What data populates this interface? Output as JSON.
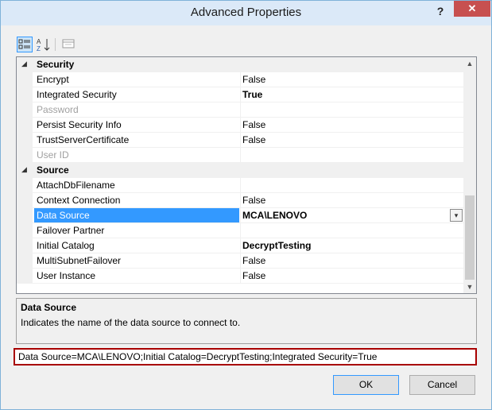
{
  "window": {
    "title": "Advanced Properties",
    "help_label": "?",
    "close_label": "✕"
  },
  "toolbar": {
    "categorized_icon": "categorized-icon",
    "alphabetical_icon": "alphabetical-sort-icon",
    "property_pages_icon": "property-pages-icon"
  },
  "grid": {
    "categories": [
      {
        "label": "Security",
        "expander": "◢",
        "properties": [
          {
            "name": "Encrypt",
            "value": "False"
          },
          {
            "name": "Integrated Security",
            "value": "True"
          },
          {
            "name": "Password",
            "value": ""
          },
          {
            "name": "Persist Security Info",
            "value": "False"
          },
          {
            "name": "TrustServerCertificate",
            "value": "False"
          },
          {
            "name": "User ID",
            "value": ""
          }
        ]
      },
      {
        "label": "Source",
        "expander": "◢",
        "properties": [
          {
            "name": "AttachDbFilename",
            "value": ""
          },
          {
            "name": "Context Connection",
            "value": "False"
          },
          {
            "name": "Data Source",
            "value": "MCA\\LENOVO"
          },
          {
            "name": "Failover Partner",
            "value": ""
          },
          {
            "name": "Initial Catalog",
            "value": "DecryptTesting"
          },
          {
            "name": "MultiSubnetFailover",
            "value": "False"
          },
          {
            "name": "User Instance",
            "value": "False"
          }
        ]
      }
    ],
    "dropdown_glyph": "▾",
    "scroll_up_glyph": "▲",
    "scroll_down_glyph": "▼"
  },
  "description": {
    "title": "Data Source",
    "text": "Indicates the name of the data source to connect to."
  },
  "connection_string": "Data Source=MCA\\LENOVO;Initial Catalog=DecryptTesting;Integrated Security=True",
  "buttons": {
    "ok": "OK",
    "cancel": "Cancel"
  },
  "colors": {
    "selection": "#3399ff",
    "highlight_border": "#a80000",
    "close_button": "#c75050"
  }
}
